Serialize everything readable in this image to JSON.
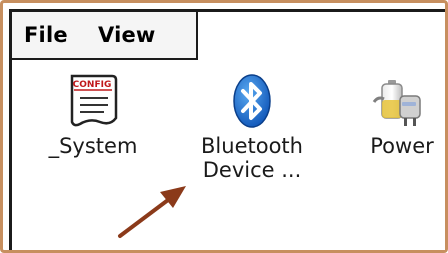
{
  "menu": {
    "file_label": "File",
    "view_label": "View"
  },
  "items": [
    {
      "label": "_System",
      "icon": "config-document-icon",
      "badge": "CONFIG"
    },
    {
      "label_line1": "Bluetooth",
      "label_line2": "Device ...",
      "icon": "bluetooth-icon"
    },
    {
      "label": "Power",
      "icon": "battery-plug-icon"
    }
  ],
  "colors": {
    "frame_border": "#c78f5f",
    "bluetooth_blue": "#1c6fd0",
    "arrow": "#8b3a1a"
  }
}
